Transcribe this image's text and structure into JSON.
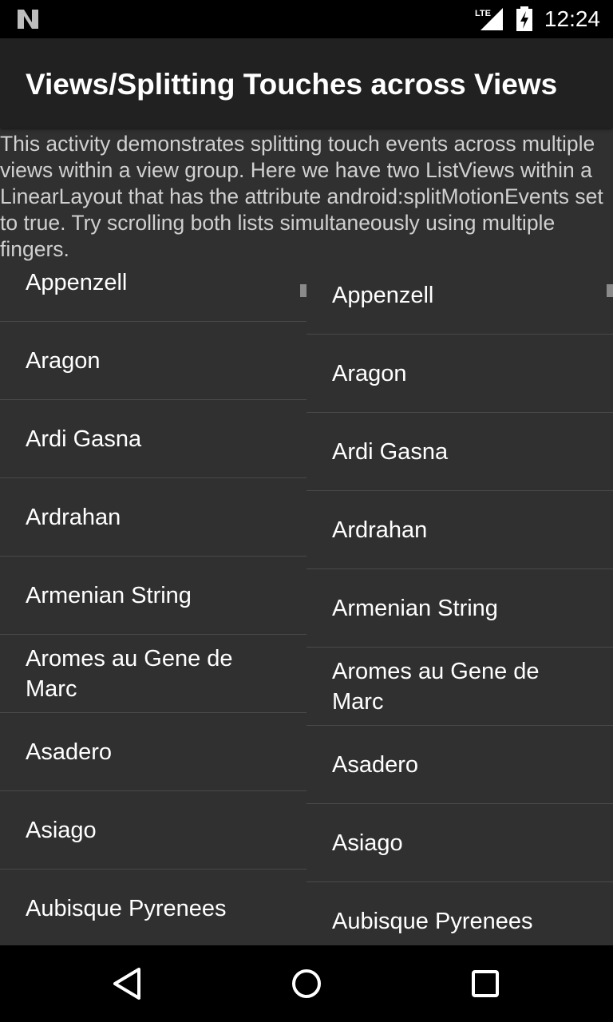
{
  "status_bar": {
    "time": "12:24",
    "network": "LTE",
    "icons": [
      "n-logo-icon",
      "signal-icon",
      "battery-charging-icon"
    ]
  },
  "action_bar": {
    "title": "Views/Splitting Touches across Views"
  },
  "description": "This activity demonstrates splitting touch events across multiple views within a view group. Here we have two ListViews within a LinearLayout that has the attribute android:splitMotionEvents set to true. Try scrolling both lists simultaneously using multiple fingers.",
  "left_list": {
    "items": [
      "Appenzell",
      "Aragon",
      "Ardi Gasna",
      "Ardrahan",
      "Armenian String",
      "Aromes au Gene de Marc",
      "Asadero",
      "Asiago",
      "Aubisque Pyrenees"
    ]
  },
  "right_list": {
    "items": [
      "Appenzell",
      "Aragon",
      "Ardi Gasna",
      "Ardrahan",
      "Armenian String",
      "Aromes au Gene de Marc",
      "Asadero",
      "Asiago",
      "Aubisque Pyrenees"
    ]
  },
  "nav_bar": {
    "icons": [
      "back-icon",
      "home-icon",
      "recents-icon"
    ]
  },
  "colors": {
    "background": "#303030",
    "action_bar": "#212121",
    "status_bar": "#000000",
    "divider": "#4a4a4a"
  }
}
